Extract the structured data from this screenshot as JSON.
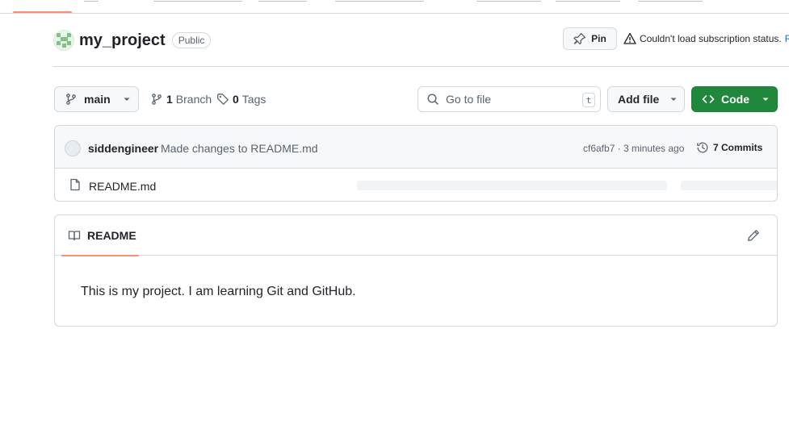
{
  "repo": {
    "name": "my_project",
    "visibility": "Public"
  },
  "header_actions": {
    "pin_label": "Pin",
    "subscription_status": "Couldn't load subscription status.",
    "retry_label": "R"
  },
  "toolbar": {
    "branch": "main",
    "branches_count": "1",
    "branches_label": "Branch",
    "tags_count": "0",
    "tags_label": "Tags",
    "goto_placeholder": "Go to file",
    "goto_shortcut": "t",
    "add_file_label": "Add file",
    "code_label": "Code"
  },
  "latest_commit": {
    "author": "siddengineer",
    "message": "Made changes to README.md",
    "hash_and_time": "cf6afb7 · 3 minutes ago",
    "commits_count_label": "7 Commits"
  },
  "files": [
    {
      "name": "README.md"
    }
  ],
  "readme": {
    "tab_label": "README",
    "content": "This is my project. I am learning Git and GitHub."
  },
  "colors": {
    "accent_underline": "#fd8c73",
    "code_button": "#1f883d",
    "link": "#0969da"
  }
}
